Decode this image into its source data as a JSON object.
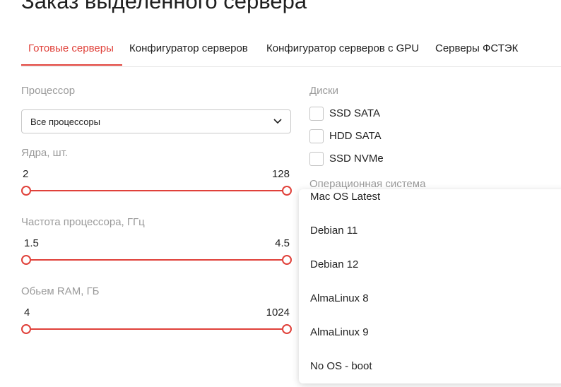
{
  "page": {
    "title": "Заказ выделенного сервера"
  },
  "tabs": [
    {
      "label": "Готовые серверы",
      "active": true
    },
    {
      "label": "Конфигуратор серверов",
      "active": false
    },
    {
      "label": "Конфигуратор серверов с GPU",
      "active": false
    },
    {
      "label": "Серверы ФСТЭК",
      "active": false
    }
  ],
  "filters": {
    "processor": {
      "label": "Процессор",
      "selected": "Все процессоры",
      "icon": "chevron-down-icon"
    },
    "cores": {
      "label": "Ядра, шт.",
      "min": "2",
      "max": "128"
    },
    "frequency": {
      "label": "Частота процессора, ГГц",
      "min": "1.5",
      "max": "4.5"
    },
    "ram": {
      "label": "Обьем RAM, ГБ",
      "min": "4",
      "max": "1024"
    },
    "disks": {
      "label": "Диски",
      "options": [
        {
          "label": "SSD SATA",
          "checked": false
        },
        {
          "label": "HDD SATA",
          "checked": false
        },
        {
          "label": "SSD NVMe",
          "checked": false
        }
      ]
    },
    "os": {
      "label": "Операционная система",
      "options": [
        "Mac OS Latest",
        "Debian 11",
        "Debian 12",
        "AlmaLinux 8",
        "AlmaLinux 9",
        "No OS - boot"
      ]
    }
  },
  "colors": {
    "accent": "#e0413a",
    "muted_text": "#9a9a9a",
    "text": "#1f1f1f"
  }
}
